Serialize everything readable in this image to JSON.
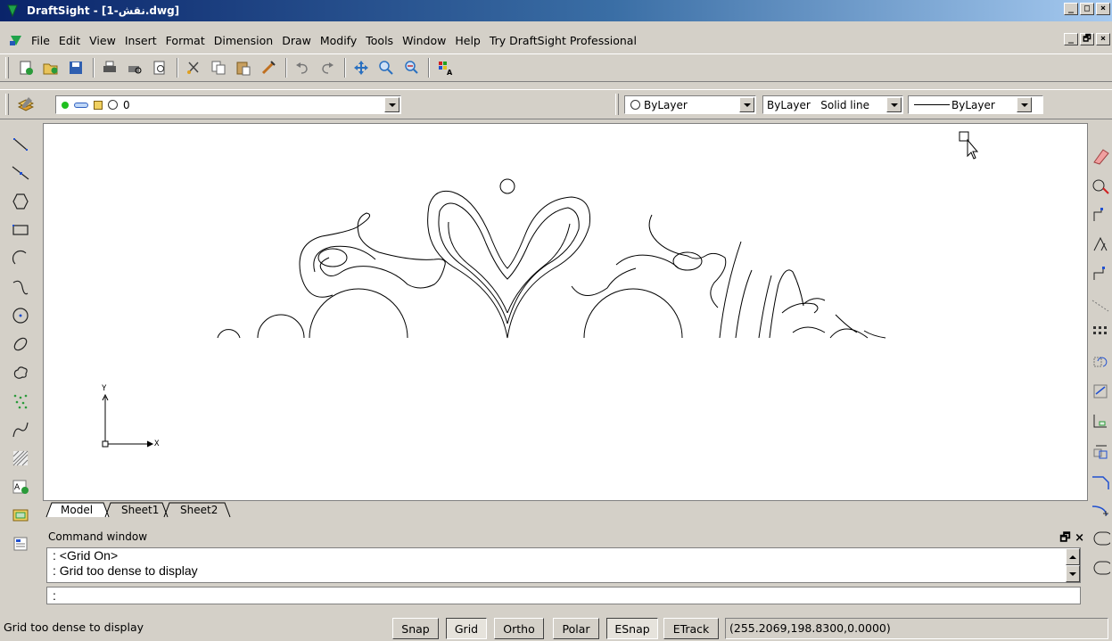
{
  "window": {
    "title": "DraftSight - [1-نقش.dwg]",
    "controls": [
      "_",
      "□",
      "×"
    ]
  },
  "menubar": {
    "items": [
      "File",
      "Edit",
      "View",
      "Insert",
      "Format",
      "Dimension",
      "Draw",
      "Modify",
      "Tools",
      "Window",
      "Help",
      "Try DraftSight Professional"
    ],
    "mdi_controls": [
      "_",
      "🗗",
      "×"
    ]
  },
  "toolbar_standard": {
    "icons": [
      "new-icon",
      "open-icon",
      "save-icon",
      "print-icon",
      "print-preview-icon",
      "page-setup-icon",
      "cut-icon",
      "copy-icon",
      "paste-icon",
      "match-properties-icon",
      "undo-icon",
      "redo-icon",
      "pan-icon",
      "zoom-window-icon",
      "zoom-previous-icon",
      "layer-manager-icon"
    ]
  },
  "toolbar_layers": {
    "layer_value": "0",
    "color_value": "ByLayer",
    "linestyle_value": "ByLayer   Solid line",
    "lineweight_value": "ByLayer"
  },
  "left_tools": [
    "line-icon",
    "infinite-line-icon",
    "polygon-icon",
    "rectangle-icon",
    "arc-icon",
    "spline-icon",
    "circle-icon",
    "ellipse-icon",
    "cloud-icon",
    "point-icon",
    "spline-fit-icon",
    "hatch-icon",
    "note-icon",
    "table-icon",
    "text-icon"
  ],
  "right_tools": [
    "erase-icon",
    "copy-icon",
    "mirror-icon",
    "offset-icon",
    "move-icon",
    "array-icon",
    "rotate-icon",
    "scale-icon",
    "stretch-icon",
    "trim-icon",
    "extend-icon",
    "break-icon",
    "chamfer-icon",
    "fillet-icon"
  ],
  "ucs": {
    "x_label": "X",
    "y_label": "Y"
  },
  "tabs": [
    "Model",
    "Sheet1",
    "Sheet2"
  ],
  "command_window": {
    "title": "Command window",
    "history": [
      ": <Grid On>",
      ": Grid too dense to display"
    ],
    "input": ":"
  },
  "statusbar": {
    "message": "Grid too dense to display",
    "buttons": [
      "Snap",
      "Grid",
      "Ortho",
      "Polar",
      "ESnap",
      "ETrack"
    ],
    "coordinates": "(255.2069,198.8300,0.0000)"
  }
}
